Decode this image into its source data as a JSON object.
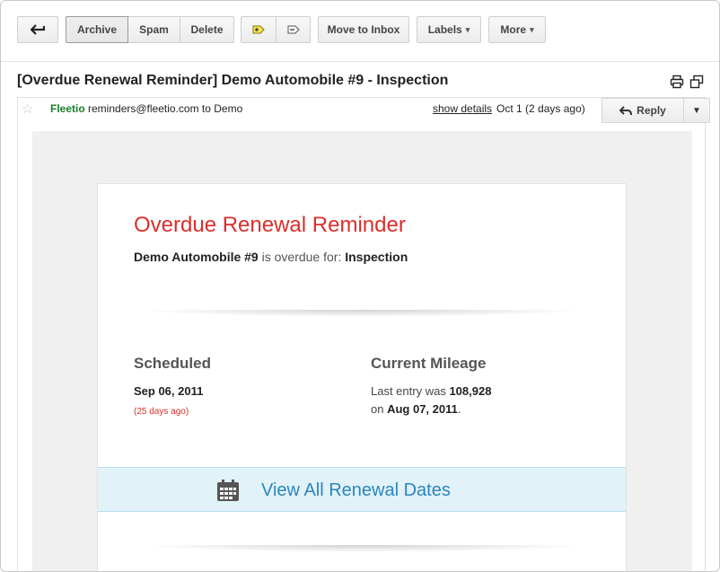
{
  "toolbar": {
    "back_icon": "back-arrow-icon",
    "archive": "Archive",
    "spam": "Spam",
    "delete": "Delete",
    "mark_important_icon": "label-add-icon",
    "mark_unimportant_icon": "label-remove-icon",
    "move_to_inbox": "Move to Inbox",
    "labels": "Labels",
    "more": "More",
    "caret": "▾"
  },
  "subject": {
    "text": "[Overdue Renewal Reminder] Demo Automobile #9 - Inspection",
    "print_icon": "print-icon",
    "new_window_icon": "new-window-icon"
  },
  "message": {
    "star": "☆",
    "sender_name": "Fleetio",
    "sender_email": "reminders@fleetio.com to Demo",
    "show_details": "show details",
    "date": "Oct 1 (2 days ago)",
    "reply": "Reply",
    "reply_more": "▼"
  },
  "email": {
    "title": "Overdue Renewal Reminder",
    "vehicle": "Demo Automobile #9",
    "overdue_text": "is overdue for:",
    "task": "Inspection",
    "scheduled_heading": "Scheduled",
    "scheduled_date": "Sep 06, 2011",
    "scheduled_overdue": "(25 days ago)",
    "mileage_heading": "Current Mileage",
    "mileage_prefix": "Last entry was",
    "mileage_value": "108,928",
    "mileage_on": "on",
    "mileage_date": "Aug 07, 2011",
    "mileage_period": ".",
    "cta_label": "View All Renewal Dates",
    "cta_icon": "calendar-icon"
  },
  "colors": {
    "accent_red": "#d9302c",
    "link_blue": "#2a86be",
    "cta_bg": "#e2f2f9",
    "sender_green": "#1a7e2a"
  }
}
